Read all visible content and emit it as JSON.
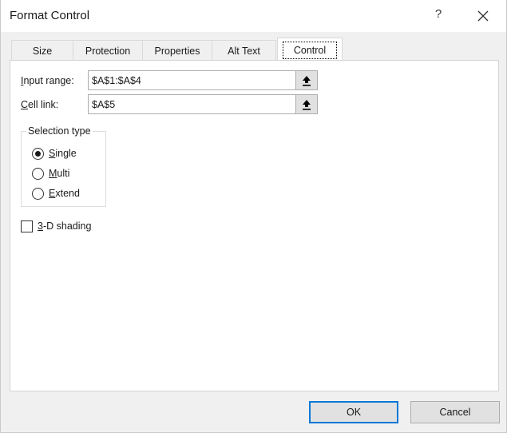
{
  "window": {
    "title": "Format Control",
    "help_label": "?",
    "close_icon": "close-icon"
  },
  "tabs": [
    {
      "label": "Size",
      "active": false
    },
    {
      "label": "Protection",
      "active": false
    },
    {
      "label": "Properties",
      "active": false
    },
    {
      "label": "Alt Text",
      "active": false
    },
    {
      "label": "Control",
      "active": true
    }
  ],
  "control": {
    "input_range": {
      "label_accel": "I",
      "label_rest": "nput range:",
      "value": "$A$1:$A$4",
      "button_icon": "collapse-dialog-icon"
    },
    "cell_link": {
      "label_accel": "C",
      "label_rest": "ell link:",
      "value": "$A$5",
      "button_icon": "collapse-dialog-icon"
    },
    "selection_type": {
      "legend": "Selection type",
      "options": [
        {
          "accel": "S",
          "rest": "ingle",
          "checked": true
        },
        {
          "accel": "M",
          "rest": "ulti",
          "checked": false
        },
        {
          "accel": "E",
          "rest": "xtend",
          "checked": false
        }
      ]
    },
    "shading": {
      "accel": "3",
      "rest": "-D shading",
      "checked": false
    }
  },
  "buttons": {
    "ok": "OK",
    "cancel": "Cancel"
  },
  "colors": {
    "default_button_border": "#0078d7",
    "panel_background": "#ffffff",
    "dialog_background": "#f0f0f0"
  }
}
